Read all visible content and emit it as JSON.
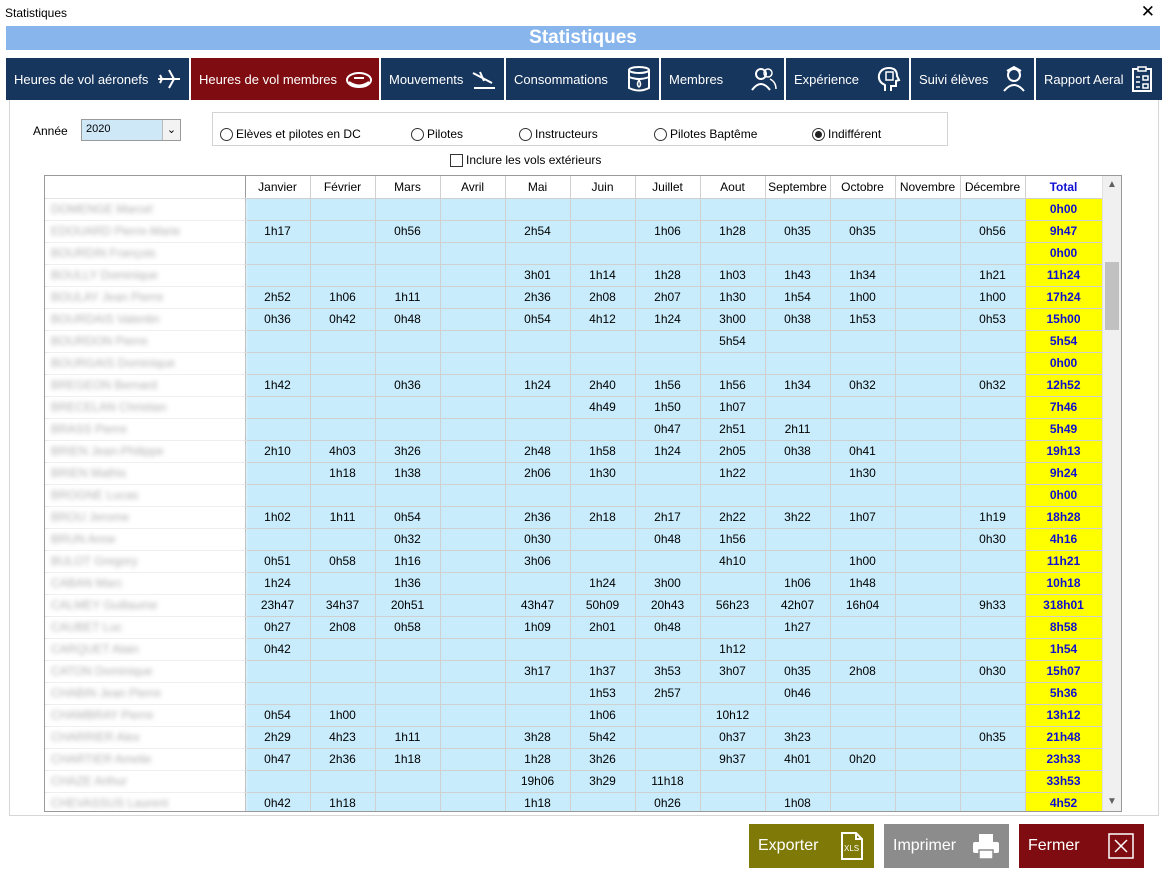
{
  "window": {
    "title": "Statistiques",
    "close_glyph": "✕"
  },
  "header": {
    "title": "Statistiques"
  },
  "tabs": [
    {
      "label": "Heures de vol aéronefs",
      "icon": "airplane-icon",
      "active": false
    },
    {
      "label": "Heures de vol membres",
      "icon": "pilot-cap-icon",
      "active": true
    },
    {
      "label": "Mouvements",
      "icon": "airplane-landing-icon",
      "active": false
    },
    {
      "label": "Consommations",
      "icon": "fuel-barrel-icon",
      "active": false
    },
    {
      "label": "Membres",
      "icon": "members-icon",
      "active": false
    },
    {
      "label": "Expérience",
      "icon": "experience-head-icon",
      "active": false
    },
    {
      "label": "Suivi élèves",
      "icon": "student-icon",
      "active": false
    },
    {
      "label": "Rapport Aeral",
      "icon": "clipboard-report-icon",
      "active": false
    }
  ],
  "filters": {
    "annee_label": "Année",
    "annee_value": "2020",
    "radios": [
      {
        "label": "Elèves et pilotes en DC",
        "checked": false
      },
      {
        "label": "Pilotes",
        "checked": false
      },
      {
        "label": "Instructeurs",
        "checked": false
      },
      {
        "label": "Pilotes Baptême",
        "checked": false
      },
      {
        "label": "Indifférent",
        "checked": true
      }
    ],
    "include_external_label": "Inclure les vols extérieurs",
    "include_external_checked": false
  },
  "grid": {
    "columns": [
      "",
      "Janvier",
      "Février",
      "Mars",
      "Avril",
      "Mai",
      "Juin",
      "Juillet",
      "Aout",
      "Septembre",
      "Octobre",
      "Novembre",
      "Décembre",
      "Total"
    ],
    "rows": [
      {
        "name": "DOMENGE Marcel",
        "values": [
          "",
          "",
          "",
          "",
          "",
          "",
          "",
          "",
          "",
          "",
          "",
          ""
        ],
        "total": "0h00"
      },
      {
        "name": "EDOUARD Pierre-Marie",
        "values": [
          "1h17",
          "",
          "0h56",
          "",
          "2h54",
          "",
          "1h06",
          "1h28",
          "0h35",
          "0h35",
          "",
          "0h56"
        ],
        "total": "9h47"
      },
      {
        "name": "BOURDIN François",
        "values": [
          "",
          "",
          "",
          "",
          "",
          "",
          "",
          "",
          "",
          "",
          "",
          ""
        ],
        "total": "0h00"
      },
      {
        "name": "BOULLY Dominique",
        "values": [
          "",
          "",
          "",
          "",
          "3h01",
          "1h14",
          "1h28",
          "1h03",
          "1h43",
          "1h34",
          "",
          "1h21"
        ],
        "total": "11h24"
      },
      {
        "name": "BOULAY Jean Pierre",
        "values": [
          "2h52",
          "1h06",
          "1h11",
          "",
          "2h36",
          "2h08",
          "2h07",
          "1h30",
          "1h54",
          "1h00",
          "",
          "1h00"
        ],
        "total": "17h24"
      },
      {
        "name": "BOURDAIS Valentin",
        "values": [
          "0h36",
          "0h42",
          "0h48",
          "",
          "0h54",
          "4h12",
          "1h24",
          "3h00",
          "0h38",
          "1h53",
          "",
          "0h53"
        ],
        "total": "15h00"
      },
      {
        "name": "BOURDON Pierre",
        "values": [
          "",
          "",
          "",
          "",
          "",
          "",
          "",
          "5h54",
          "",
          "",
          "",
          ""
        ],
        "total": "5h54"
      },
      {
        "name": "BOURGAIS Dominique",
        "values": [
          "",
          "",
          "",
          "",
          "",
          "",
          "",
          "",
          "",
          "",
          "",
          ""
        ],
        "total": "0h00"
      },
      {
        "name": "BREGEON Bernard",
        "values": [
          "1h42",
          "",
          "0h36",
          "",
          "1h24",
          "2h40",
          "1h56",
          "1h56",
          "1h34",
          "0h32",
          "",
          "0h32"
        ],
        "total": "12h52"
      },
      {
        "name": "BRECELAN Christian",
        "values": [
          "",
          "",
          "",
          "",
          "",
          "4h49",
          "1h50",
          "1h07",
          "",
          "",
          "",
          ""
        ],
        "total": "7h46"
      },
      {
        "name": "BRASS Pierre",
        "values": [
          "",
          "",
          "",
          "",
          "",
          "",
          "0h47",
          "2h51",
          "2h11",
          "",
          "",
          ""
        ],
        "total": "5h49"
      },
      {
        "name": "BRIEN Jean-Philippe",
        "values": [
          "2h10",
          "4h03",
          "3h26",
          "",
          "2h48",
          "1h58",
          "1h24",
          "2h05",
          "0h38",
          "0h41",
          "",
          ""
        ],
        "total": "19h13"
      },
      {
        "name": "BRIEN Mathis",
        "values": [
          "",
          "1h18",
          "1h38",
          "",
          "2h06",
          "1h30",
          "",
          "1h22",
          "",
          "1h30",
          "",
          ""
        ],
        "total": "9h24"
      },
      {
        "name": "BROGNE Lucas",
        "values": [
          "",
          "",
          "",
          "",
          "",
          "",
          "",
          "",
          "",
          "",
          "",
          ""
        ],
        "total": "0h00"
      },
      {
        "name": "BROU Jerome",
        "values": [
          "1h02",
          "1h11",
          "0h54",
          "",
          "2h36",
          "2h18",
          "2h17",
          "2h22",
          "3h22",
          "1h07",
          "",
          "1h19"
        ],
        "total": "18h28"
      },
      {
        "name": "BRUN Anne",
        "values": [
          "",
          "",
          "0h32",
          "",
          "0h30",
          "",
          "0h48",
          "1h56",
          "",
          "",
          "",
          "0h30"
        ],
        "total": "4h16"
      },
      {
        "name": "BULOT Gregory",
        "values": [
          "0h51",
          "0h58",
          "1h16",
          "",
          "3h06",
          "",
          "",
          "4h10",
          "",
          "1h00",
          "",
          ""
        ],
        "total": "11h21"
      },
      {
        "name": "CABAN Marc",
        "values": [
          "1h24",
          "",
          "1h36",
          "",
          "",
          "1h24",
          "3h00",
          "",
          "1h06",
          "1h48",
          "",
          ""
        ],
        "total": "10h18"
      },
      {
        "name": "CALMEY Guillaume",
        "values": [
          "23h47",
          "34h37",
          "20h51",
          "",
          "43h47",
          "50h09",
          "20h43",
          "56h23",
          "42h07",
          "16h04",
          "",
          "9h33"
        ],
        "total": "318h01"
      },
      {
        "name": "CAUBET Luc",
        "values": [
          "0h27",
          "2h08",
          "0h58",
          "",
          "1h09",
          "2h01",
          "0h48",
          "",
          "1h27",
          "",
          "",
          ""
        ],
        "total": "8h58"
      },
      {
        "name": "CARQUET Alain",
        "values": [
          "0h42",
          "",
          "",
          "",
          "",
          "",
          "",
          "1h12",
          "",
          "",
          "",
          ""
        ],
        "total": "1h54"
      },
      {
        "name": "CATON Dominique",
        "values": [
          "",
          "",
          "",
          "",
          "3h17",
          "1h37",
          "3h53",
          "3h07",
          "0h35",
          "2h08",
          "",
          "0h30"
        ],
        "total": "15h07"
      },
      {
        "name": "CHABIN Jean Pierre",
        "values": [
          "",
          "",
          "",
          "",
          "",
          "1h53",
          "2h57",
          "",
          "0h46",
          "",
          "",
          ""
        ],
        "total": "5h36"
      },
      {
        "name": "CHAMBRAY Pierre",
        "values": [
          "0h54",
          "1h00",
          "",
          "",
          "",
          "1h06",
          "",
          "10h12",
          "",
          "",
          "",
          ""
        ],
        "total": "13h12"
      },
      {
        "name": "CHARRIER Alex",
        "values": [
          "2h29",
          "4h23",
          "1h11",
          "",
          "3h28",
          "5h42",
          "",
          "0h37",
          "3h23",
          "",
          "",
          "0h35"
        ],
        "total": "21h48"
      },
      {
        "name": "CHARTIER Amelie",
        "values": [
          "0h47",
          "2h36",
          "1h18",
          "",
          "1h28",
          "3h26",
          "",
          "9h37",
          "4h01",
          "0h20",
          "",
          ""
        ],
        "total": "23h33"
      },
      {
        "name": "CHAZE Arthur",
        "values": [
          "",
          "",
          "",
          "",
          "19h06",
          "3h29",
          "11h18",
          "",
          "",
          "",
          "",
          ""
        ],
        "total": "33h53"
      },
      {
        "name": "CHEVASSUS Laurent",
        "values": [
          "0h42",
          "1h18",
          "",
          "",
          "1h18",
          "",
          "0h26",
          "",
          "1h08",
          "",
          "",
          ""
        ],
        "total": "4h52"
      }
    ]
  },
  "buttons": {
    "export": {
      "label": "Exporter",
      "icon": "xls-file-icon",
      "color": "#7f7a08"
    },
    "print": {
      "label": "Imprimer",
      "icon": "printer-icon",
      "color": "#8c8c8c"
    },
    "close": {
      "label": "Fermer",
      "icon": "close-box-icon",
      "color": "#7f0c10"
    }
  },
  "colors": {
    "header_band": "#88b6ec",
    "tab_bg": "#17365d",
    "tab_active_bg": "#7f0c10",
    "cell_bg": "#c8ecfc",
    "total_bg": "#ffff00",
    "total_text": "#1010d0"
  }
}
